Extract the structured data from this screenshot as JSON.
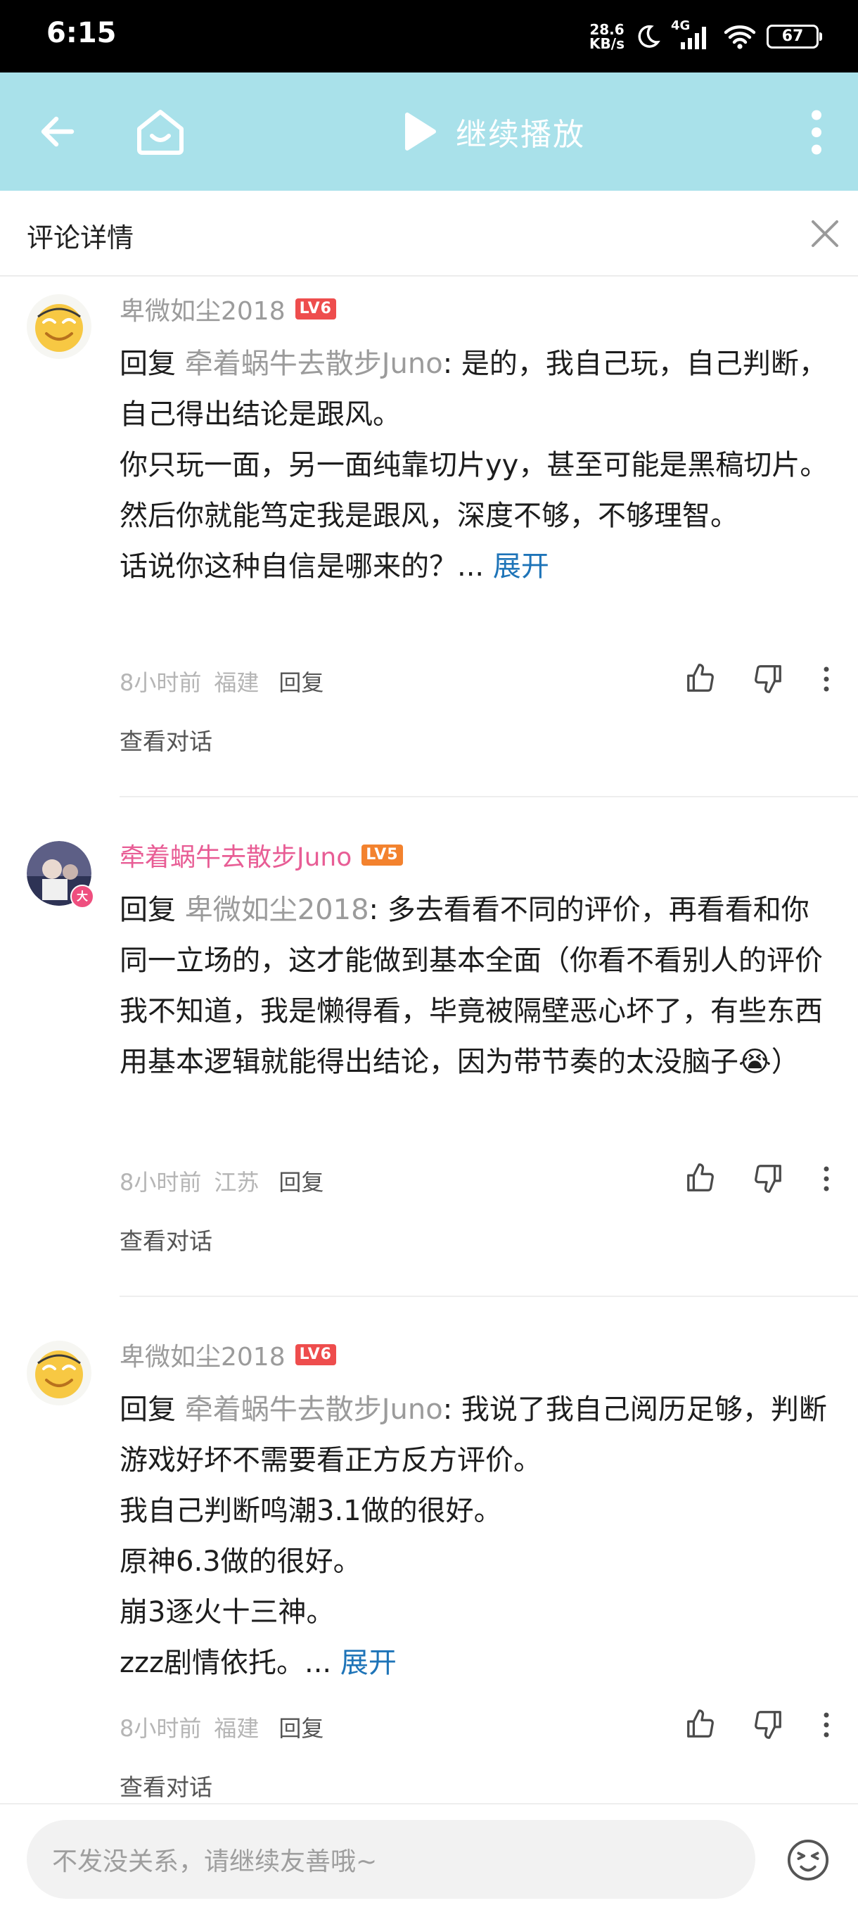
{
  "status_bar": {
    "time": "6:15",
    "net_speed_value": "28.6",
    "net_speed_unit": "KB/s",
    "network": "4G",
    "battery": "67"
  },
  "app_bar": {
    "play_label": "继续播放"
  },
  "panel": {
    "title": "评论详情"
  },
  "comments": [
    {
      "username": "卑微如尘2018",
      "level": "LV6",
      "reply_word": "回复",
      "mention": "牵着蜗牛去散步Juno",
      "colon": ":",
      "lines": [
        "是的，我自己玩，自己判断，自己得出结论是跟风。",
        "你只玩一面，另一面纯靠切片yy，甚至可能是黑稿切片。",
        "然后你就能笃定我是跟风，深度不够，不够理智。",
        "话说你这种自信是哪来的？..."
      ],
      "expand": "展开",
      "time": "8小时前",
      "location": "福建",
      "reply_label": "回复",
      "view_conversation": "查看对话"
    },
    {
      "username": "牵着蜗牛去散步Juno",
      "level": "LV5",
      "avatar_badge": "大",
      "reply_word": "回复",
      "mention": "卑微如尘2018",
      "colon": ":",
      "text": "多去看看不同的评价，再看看和你同一立场的，这才能做到基本全面（你看不看别人的评价我不知道，我是懒得看，毕竟被隔壁恶心坏了，有些东西用基本逻辑就能得出结论，因为带节奏的太没脑子",
      "emoji": "😭",
      "closing": "）",
      "time": "8小时前",
      "location": "江苏",
      "reply_label": "回复",
      "view_conversation": "查看对话"
    },
    {
      "username": "卑微如尘2018",
      "level": "LV6",
      "reply_word": "回复",
      "mention": "牵着蜗牛去散步Juno",
      "colon": ":",
      "lines": [
        "我说了我自己阅历足够，判断游戏好坏不需要看正方反方评价。",
        "我自己判断鸣潮3.1做的很好。",
        "原神6.3做的很好。",
        "崩3逐火十三神。",
        "zzz剧情依托。..."
      ],
      "expand": "展开",
      "time": "8小时前",
      "location": "福建",
      "reply_label": "回复",
      "view_conversation": "查看对话"
    }
  ],
  "input": {
    "placeholder": "不发没关系，请继续友善哦~"
  },
  "colors": {
    "app_bar_bg": "#a9e1ea",
    "link": "#1e74b8",
    "pink_name": "#e85d95",
    "level6": "#ee4d4d",
    "level5": "#f3822e"
  },
  "icons": [
    "back-arrow-icon",
    "home-icon",
    "play-icon",
    "more-vert-icon",
    "close-icon",
    "like-icon",
    "dislike-icon",
    "emoji-icon"
  ]
}
